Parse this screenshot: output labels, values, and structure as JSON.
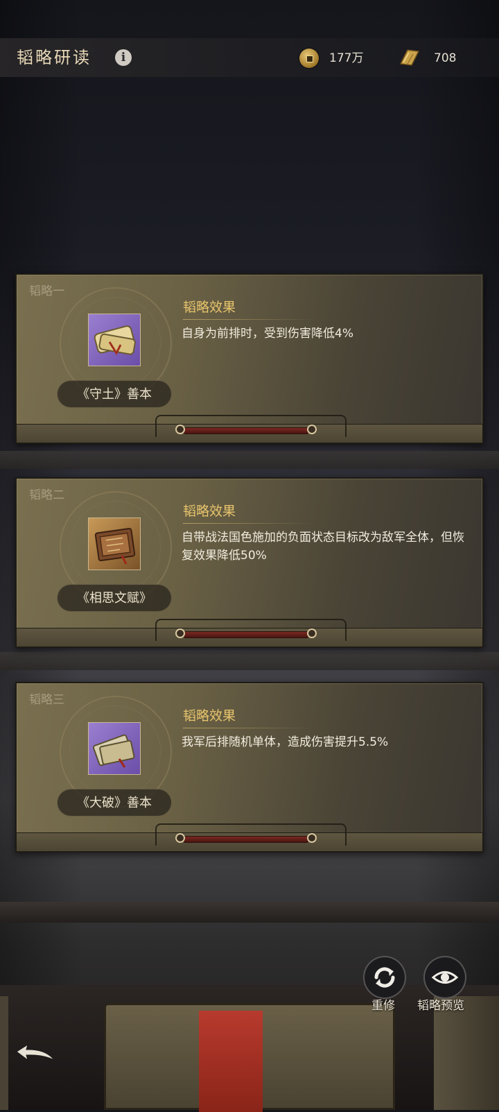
{
  "header": {
    "title": "韬略研读",
    "coins_value": "177万",
    "scrolls_value": "708"
  },
  "cards": [
    {
      "slot_label": "韬略一",
      "item_name": "《守土》善本",
      "effect_title": "韬略效果",
      "effect_text": "自身为前排时，受到伤害降低4%",
      "item_icon": "scroll-bundle-icon"
    },
    {
      "slot_label": "韬略二",
      "item_name": "《相思文赋》",
      "effect_title": "韬略效果",
      "effect_text": "自带战法国色施加的负面状态目标改为敌军全体，但恢复效果降低50%",
      "item_icon": "book-bundle-icon"
    },
    {
      "slot_label": "韬略三",
      "item_name": "《大破》善本",
      "effect_title": "韬略效果",
      "effect_text": "我军后排随机单体，造成伤害提升5.5%",
      "item_icon": "scroll-bundle-icon"
    }
  ],
  "actions": {
    "rebuild_label": "重修",
    "preview_label": "韬略预览"
  },
  "colors": {
    "accent_gold": "#e8c56c",
    "card_bg": "#6a6145",
    "item_purple": "#7a5cc0",
    "item_gold": "#a87a40"
  }
}
